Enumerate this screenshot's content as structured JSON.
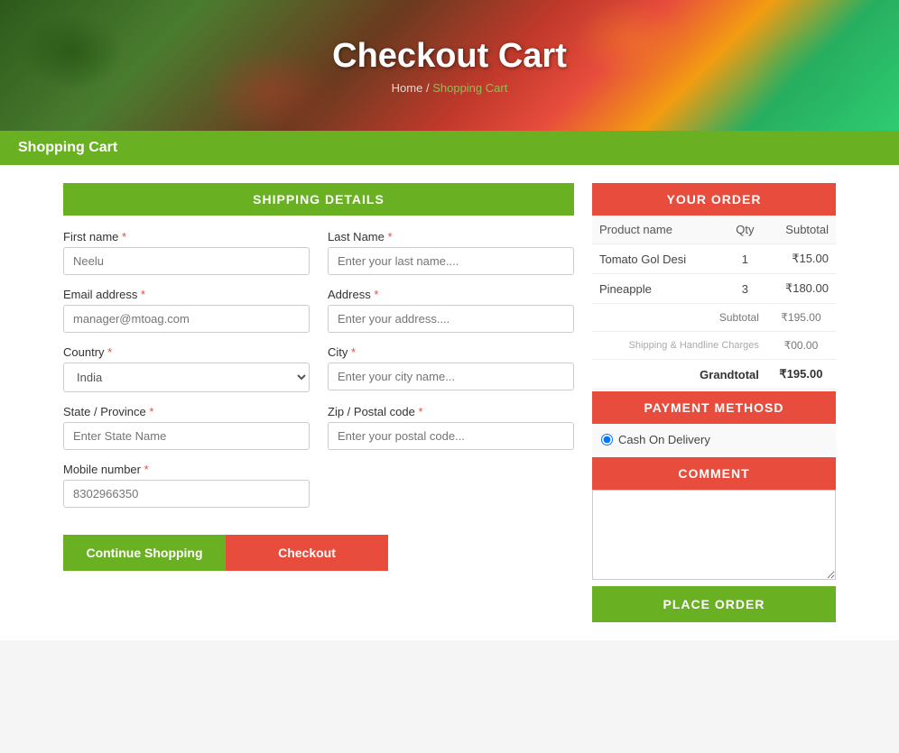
{
  "hero": {
    "title": "Checkout Cart",
    "breadcrumb_home": "Home",
    "breadcrumb_separator": " / ",
    "breadcrumb_current": "Shopping Cart"
  },
  "section_bar": {
    "label": "Shopping Cart"
  },
  "shipping": {
    "header": "SHIPPING DETAILS",
    "fields": {
      "first_name_label": "First name",
      "first_name_placeholder": "Neelu",
      "last_name_label": "Last Name",
      "last_name_placeholder": "Enter your last name....",
      "email_label": "Email address",
      "email_placeholder": "manager@mtoag.com",
      "address_label": "Address",
      "address_placeholder": "Enter your address....",
      "country_label": "Country",
      "country_value": "India",
      "city_label": "City",
      "city_placeholder": "Enter your city name...",
      "state_label": "State / Province",
      "state_placeholder": "Enter State Name",
      "zip_label": "Zip / Postal code",
      "zip_placeholder": "Enter your postal code...",
      "mobile_label": "Mobile number",
      "mobile_placeholder": "8302966350"
    }
  },
  "buttons": {
    "continue_shopping": "Continue Shopping",
    "checkout": "Checkout"
  },
  "order": {
    "header": "YOUR ORDER",
    "columns": [
      "Product name",
      "Qty",
      "Subtotal"
    ],
    "items": [
      {
        "name": "Tomato Gol Desi",
        "qty": "1",
        "subtotal": "₹15.00"
      },
      {
        "name": "Pineapple",
        "qty": "3",
        "subtotal": "₹180.00"
      }
    ],
    "subtotal_label": "Subtotal",
    "subtotal_value": "₹195.00",
    "shipping_label": "Shipping & Handline Charges",
    "shipping_value": "₹00.00",
    "grandtotal_label": "Grandtotal",
    "grandtotal_value": "₹195.00"
  },
  "payment": {
    "header": "PAYMENT METHOSD",
    "option": "Cash On Delivery"
  },
  "comment": {
    "header": "COMMENT"
  },
  "place_order": {
    "label": "PLACE ORDER"
  }
}
